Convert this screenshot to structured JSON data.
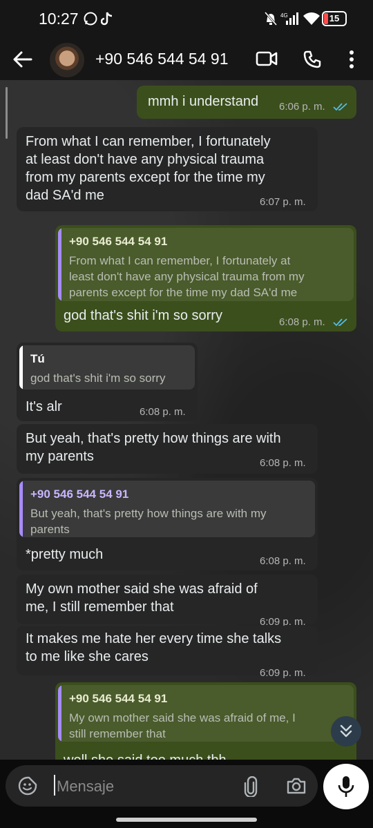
{
  "status_bar": {
    "time": "10:27",
    "battery": "15"
  },
  "header": {
    "contact": "+90 546 544 54 91"
  },
  "messages": [
    {
      "dir": "out",
      "text": "mmh i understand",
      "time": "6:06 p. m."
    },
    {
      "dir": "in",
      "lines": [
        "From what I can remember, I fortunately",
        "at least don't have any physical trauma",
        "from my parents except for the time my",
        "dad SA'd me"
      ],
      "time": "6:07 p. m."
    },
    {
      "dir": "out",
      "quote": {
        "name": "+90 546 544 54 91",
        "lines": [
          "From what I can remember, I fortunately at",
          "least don't have any physical trauma from my",
          "parents except for the time my dad SA'd me"
        ]
      },
      "text": "god that's shit i'm so sorry",
      "time": "6:08 p. m."
    },
    {
      "dir": "in",
      "quote": {
        "name": "Tú",
        "lines": [
          "god that's shit i'm so sorry"
        ]
      },
      "text": "It's alr",
      "time": "6:08 p. m."
    },
    {
      "dir": "in",
      "lines": [
        "But yeah, that's pretty how things are with",
        "my parents"
      ],
      "time": "6:08 p. m."
    },
    {
      "dir": "in",
      "quote": {
        "name": "+90 546 544 54 91",
        "lines": [
          "But yeah, that's pretty how things are with my",
          "parents"
        ]
      },
      "text": "*pretty much",
      "time": "6:08 p. m."
    },
    {
      "dir": "in",
      "lines": [
        "My own mother said she was afraid of",
        "me, I still remember that"
      ],
      "time": "6:09 p. m."
    },
    {
      "dir": "in",
      "lines": [
        "It makes me hate her every time she talks",
        "to me like she cares"
      ],
      "time": "6:09 p. m."
    },
    {
      "dir": "out",
      "quote": {
        "name": "+90 546 544 54 91",
        "lines": [
          "My own mother said she was afraid of me, I",
          "still remember that"
        ]
      },
      "text": "well she said too much tbh"
    }
  ],
  "input": {
    "placeholder": "Mensaje"
  },
  "colors": {
    "outgoing": "#3b4f1c",
    "incoming": "#262626",
    "quote_accent": "#a78bfa",
    "quote_name_in": "#ffffff",
    "read_ticks": "#53bdeb"
  },
  "icons": [
    "whatsapp-icon",
    "tiktok-icon",
    "mute-icon",
    "signal-icon",
    "wifi-icon",
    "back-arrow-icon",
    "video-call-icon",
    "phone-call-icon",
    "more-vert-icon",
    "double-check-icon",
    "scroll-down-icon",
    "sticker-icon",
    "attach-icon",
    "camera-icon",
    "mic-icon"
  ]
}
